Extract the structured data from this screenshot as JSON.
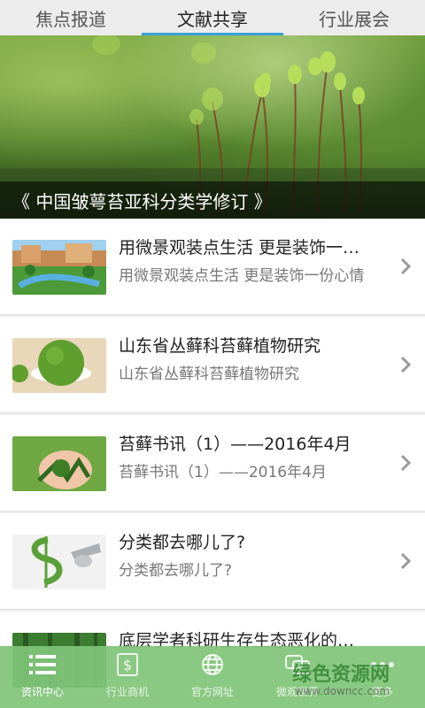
{
  "tabs": [
    {
      "label": "焦点报道"
    },
    {
      "label": "文献共享"
    },
    {
      "label": "行业展会"
    }
  ],
  "banner": {
    "caption": "《 中国皱萼苔亚科分类学修订 》"
  },
  "articles": [
    {
      "title": "用微景观装点生活 更是装饰一…",
      "subtitle": "用微景观装点生活 更是装饰一份心情"
    },
    {
      "title": "山东省丛藓科苔藓植物研究",
      "subtitle": "山东省丛藓科苔藓植物研究"
    },
    {
      "title": "苔藓书讯（1）——2016年4月",
      "subtitle": "苔藓书讯（1）——2016年4月"
    },
    {
      "title": "分类都去哪儿了?",
      "subtitle": "分类都去哪儿了?"
    },
    {
      "title": "底层学者科研生存生态恶化的…",
      "subtitle": ""
    }
  ],
  "bottom_nav": [
    {
      "label": "资讯中心",
      "icon": "list-icon"
    },
    {
      "label": "行业商机",
      "icon": "dollar-icon"
    },
    {
      "label": "官方网址",
      "icon": "globe-icon"
    },
    {
      "label": "微观世界",
      "icon": "chat-icon"
    },
    {
      "label": "更多",
      "icon": "more-icon"
    }
  ],
  "watermark": {
    "name": "绿色资源网",
    "url": "www.downcc.com"
  },
  "colors": {
    "accent": "#39a0d8",
    "nav_bg": "#80c478"
  }
}
